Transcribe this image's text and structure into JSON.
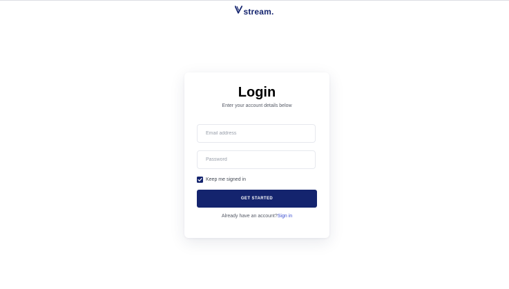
{
  "brand": {
    "logo_text": "stream.",
    "color": "#14246e"
  },
  "login": {
    "title": "Login",
    "subtitle": "Enter your account details below",
    "email_placeholder": "Email address",
    "password_placeholder": "Password",
    "remember_label": "Keep me signed in",
    "remember_checked": true,
    "submit_label": "GET STARTED",
    "footer_text": "Already have an account?",
    "signin_link": "Sign in"
  },
  "colors": {
    "primary": "#14246e",
    "link": "#3b4fd1"
  }
}
